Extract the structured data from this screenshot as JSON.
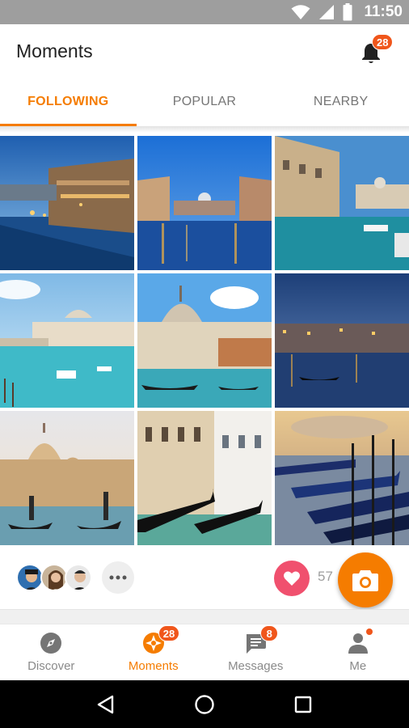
{
  "status_bar": {
    "time": "11:50",
    "icons": [
      "wifi-icon",
      "signal-icon",
      "battery-icon"
    ]
  },
  "header": {
    "title": "Moments",
    "notification_count": "28"
  },
  "tabs": [
    {
      "label": "FOLLOWING",
      "active": true
    },
    {
      "label": "POPULAR",
      "active": false
    },
    {
      "label": "NEARBY",
      "active": false
    }
  ],
  "photos": [
    "venice-grand-canal-dusk",
    "venice-canal-blue-hour",
    "venice-canal-boats-day",
    "venice-basilica-turquoise",
    "venice-basilica-gondola",
    "venice-canal-night",
    "venice-gondoliers-sunset",
    "venice-gondolas-facade",
    "venice-gondolas-moored"
  ],
  "actions": {
    "like_count": "57",
    "avatar_count": 3
  },
  "bottom_nav": [
    {
      "label": "Discover",
      "icon": "compass-icon",
      "badge": "",
      "active": false
    },
    {
      "label": "Moments",
      "icon": "aperture-icon",
      "badge": "28",
      "active": true
    },
    {
      "label": "Messages",
      "icon": "chat-icon",
      "badge": "8",
      "active": false
    },
    {
      "label": "Me",
      "icon": "person-icon",
      "badge": "",
      "dot": true,
      "active": false
    }
  ],
  "colors": {
    "accent": "#f57c00",
    "badge": "#f0561b",
    "like": "#f0506e",
    "status_bar": "#9e9e9e"
  }
}
